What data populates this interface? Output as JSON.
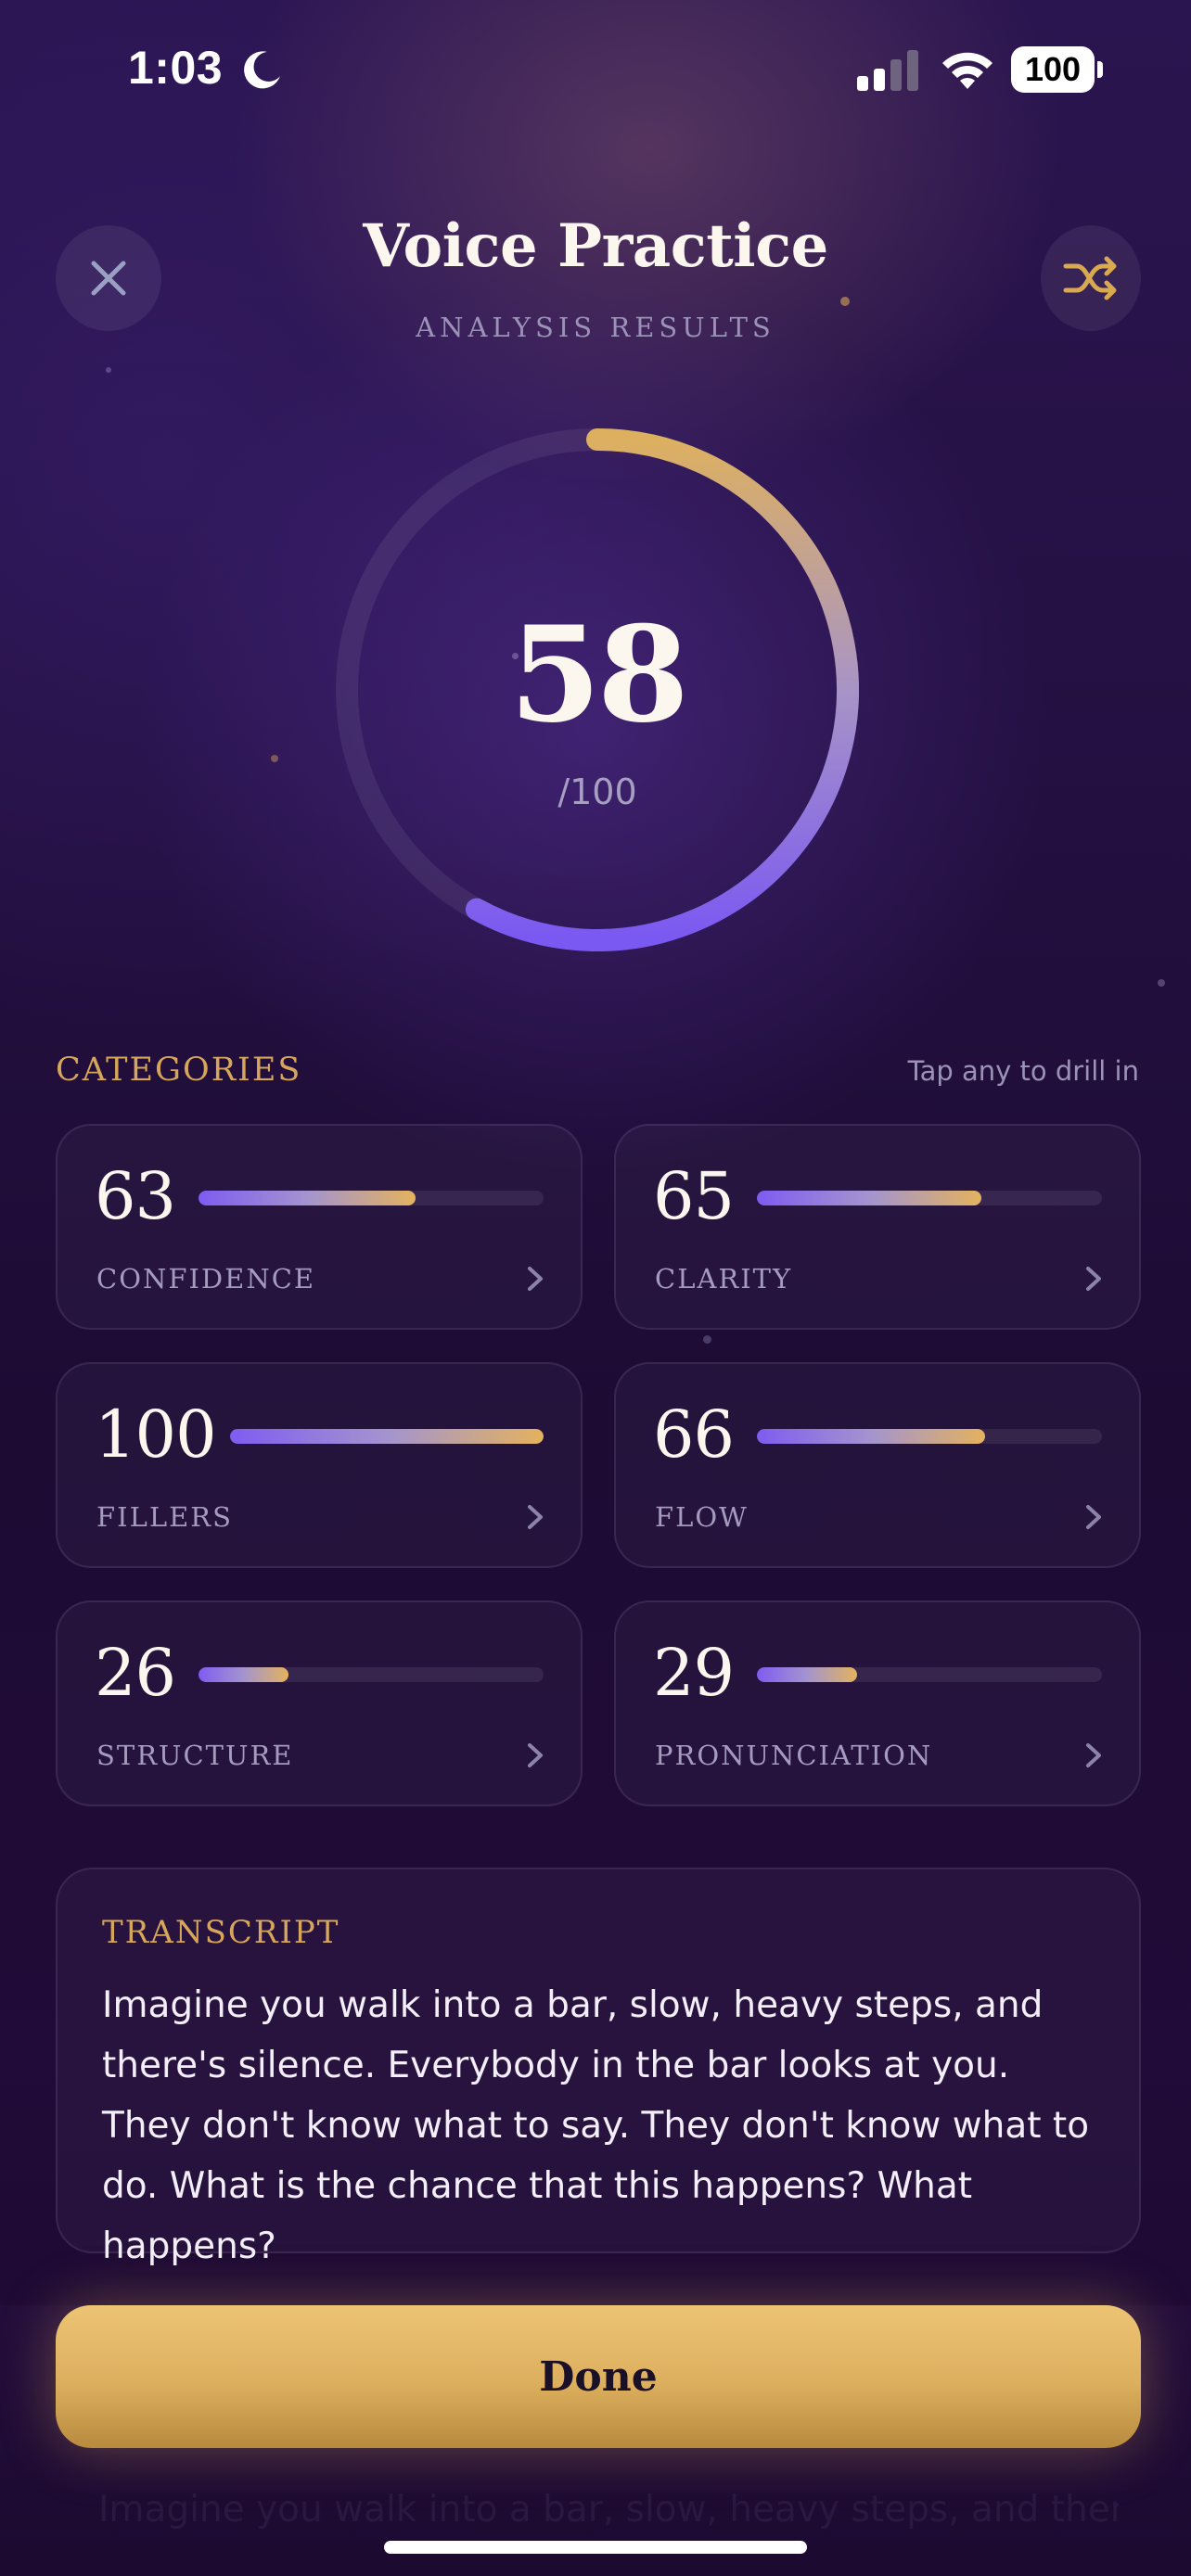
{
  "status_bar": {
    "time": "1:03",
    "battery": "100"
  },
  "header": {
    "title": "Voice Practice",
    "subtitle": "ANALYSIS RESULTS",
    "close_icon": "close-icon",
    "shuffle_icon": "shuffle-icon"
  },
  "score": {
    "value": "58",
    "max_label": "/100",
    "fraction": 0.58
  },
  "categories": {
    "title": "CATEGORIES",
    "hint": "Tap any to drill in",
    "items": [
      {
        "value": "63",
        "label": "CONFIDENCE",
        "fill": 0.63
      },
      {
        "value": "65",
        "label": "CLARITY",
        "fill": 0.65
      },
      {
        "value": "100",
        "label": "FILLERS",
        "fill": 1.0
      },
      {
        "value": "66",
        "label": "FLOW",
        "fill": 0.66
      },
      {
        "value": "26",
        "label": "STRUCTURE",
        "fill": 0.26
      },
      {
        "value": "29",
        "label": "PRONUNCIATION",
        "fill": 0.29
      }
    ]
  },
  "transcript": {
    "title": "TRANSCRIPT",
    "text": "Imagine you walk into a bar, slow, heavy steps, and there's silence. Everybody in the bar looks at you. They don't know what to say. They don't know what to do. What is the chance that this happens? What happens?"
  },
  "footer": {
    "done_label": "Done"
  },
  "colors": {
    "accent_gold": "#d6a65a",
    "accent_purple": "#7f5cf0",
    "background": "#241041"
  }
}
